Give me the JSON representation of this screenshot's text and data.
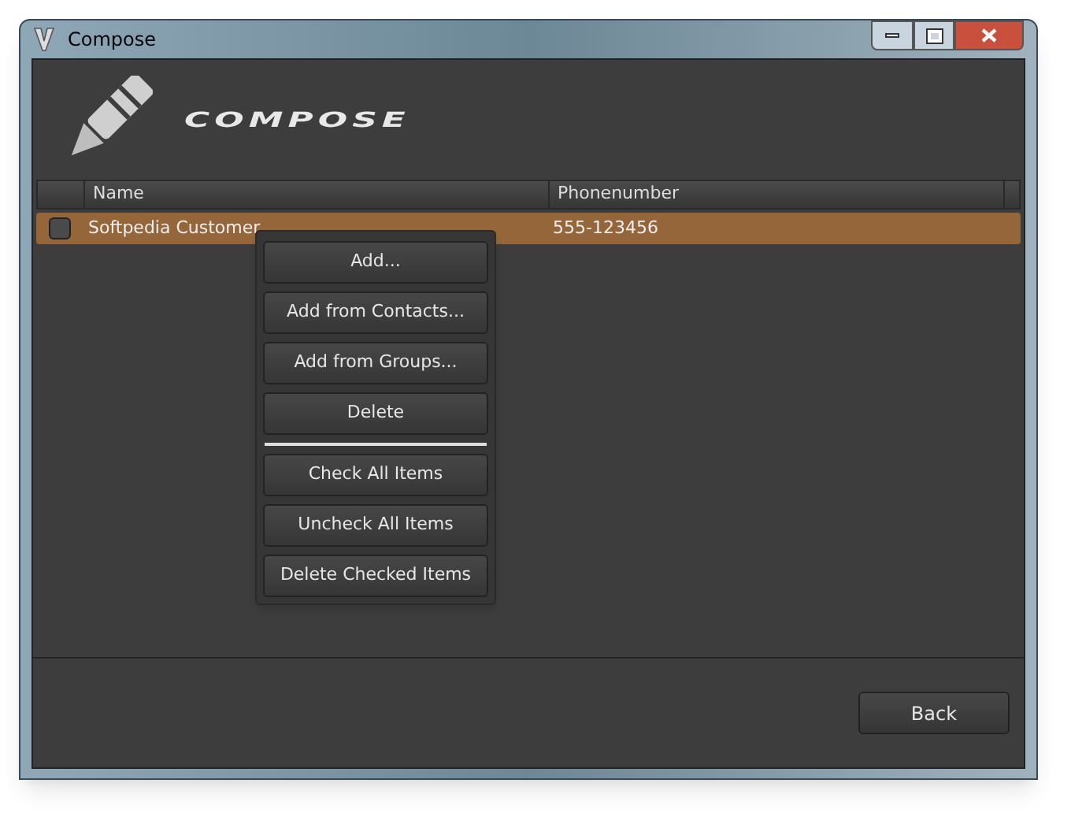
{
  "window": {
    "title": "Compose"
  },
  "header": {
    "title": "COMPOSE"
  },
  "table": {
    "columns": [
      "Name",
      "Phonenumber"
    ],
    "rows": [
      {
        "name": "Softpedia Customer",
        "phone": "555-123456",
        "checked": false,
        "selected": true
      }
    ]
  },
  "context_menu": {
    "items": [
      {
        "kind": "button",
        "label": "Add..."
      },
      {
        "kind": "button",
        "label": "Add from Contacts..."
      },
      {
        "kind": "button",
        "label": "Add from Groups..."
      },
      {
        "kind": "button",
        "label": "Delete"
      },
      {
        "kind": "separator"
      },
      {
        "kind": "button",
        "label": "Check All Items"
      },
      {
        "kind": "button",
        "label": "Uncheck All Items"
      },
      {
        "kind": "button",
        "label": "Delete Checked Items"
      }
    ]
  },
  "footer": {
    "back_button": "Back"
  }
}
